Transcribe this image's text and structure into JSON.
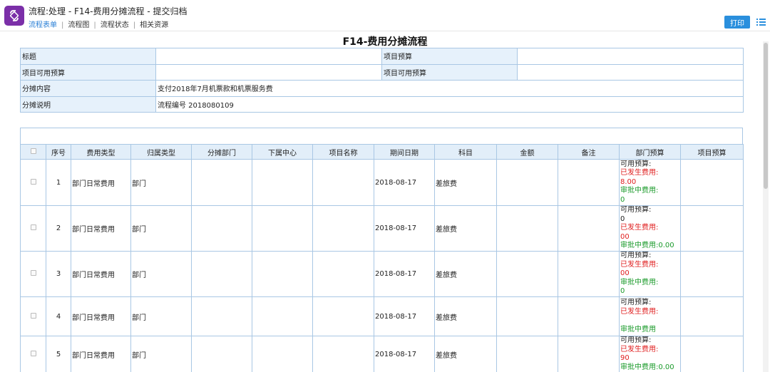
{
  "header": {
    "title": "流程:处理 - F14-费用分摊流程 - 提交归档",
    "tabs": [
      "流程表单",
      "流程图",
      "流程状态",
      "相关资源"
    ],
    "print_label": "打印"
  },
  "form": {
    "title": "F14-费用分摊流程",
    "fields": {
      "title_label": "标题",
      "title_value": "",
      "project_budget_label": "项目预算",
      "project_budget_value": "",
      "avail_budget_label": "项目可用预算",
      "avail_budget_value": "",
      "avail_budget_label_2": "项目可用预算",
      "avail_budget_value_2": "",
      "content_label": "分摊内容",
      "content_value": "支付2018年7月机票款和机票服务费",
      "desc_label": "分摊说明",
      "desc_value": "流程编号 2018080109"
    }
  },
  "grid": {
    "columns": [
      "",
      "序号",
      "费用类型",
      "归属类型",
      "分摊部门",
      "下属中心",
      "项目名称",
      "期间日期",
      "科目",
      "金额",
      "备注",
      "部门预算",
      "项目预算"
    ],
    "rows": [
      {
        "no": "1",
        "expense_type": "部门日常费用",
        "belong_type": "部门",
        "dept": "",
        "center": "",
        "project": "",
        "date": "2018-08-17",
        "subject": "差旅费",
        "amount": "",
        "remark": "",
        "budget": [
          "可用预算:",
          "已发生费用:",
          "8.00",
          "审批中费用:",
          "0"
        ],
        "proj_budget": ""
      },
      {
        "no": "2",
        "expense_type": "部门日常费用",
        "belong_type": "部门",
        "dept": "",
        "center": "",
        "project": "",
        "date": "2018-08-17",
        "subject": "差旅费",
        "amount": "",
        "remark": "",
        "budget": [
          "可用预算:",
          "0",
          "已发生费用:",
          "00",
          "审批中费用:0.00"
        ],
        "proj_budget": ""
      },
      {
        "no": "3",
        "expense_type": "部门日常费用",
        "belong_type": "部门",
        "dept": "",
        "center": "",
        "project": "",
        "date": "2018-08-17",
        "subject": "差旅费",
        "amount": "",
        "remark": "",
        "budget": [
          "可用预算:",
          "已发生费用:",
          "00",
          "审批中费用:",
          "0"
        ],
        "proj_budget": ""
      },
      {
        "no": "4",
        "expense_type": "部门日常费用",
        "belong_type": "部门",
        "dept": "",
        "center": "",
        "project": "",
        "date": "2018-08-17",
        "subject": "差旅费",
        "amount": "",
        "remark": "",
        "budget": [
          "可用预算:",
          "已发生费用:",
          "",
          "审批中费用"
        ],
        "proj_budget": ""
      },
      {
        "no": "5",
        "expense_type": "部门日常费用",
        "belong_type": "部门",
        "dept": "",
        "center": "",
        "project": "",
        "date": "2018-08-17",
        "subject": "差旅费",
        "amount": "",
        "remark": "",
        "budget": [
          "可用预算:",
          "已发生费用:",
          "90",
          "审批中费用:0.00"
        ],
        "proj_budget": ""
      }
    ]
  },
  "colors": {
    "accent": "#2a8fdd",
    "brand": "#7b2fa8",
    "used": "#e02020",
    "pending": "#1a9a2a",
    "border": "#a9c7e4"
  }
}
